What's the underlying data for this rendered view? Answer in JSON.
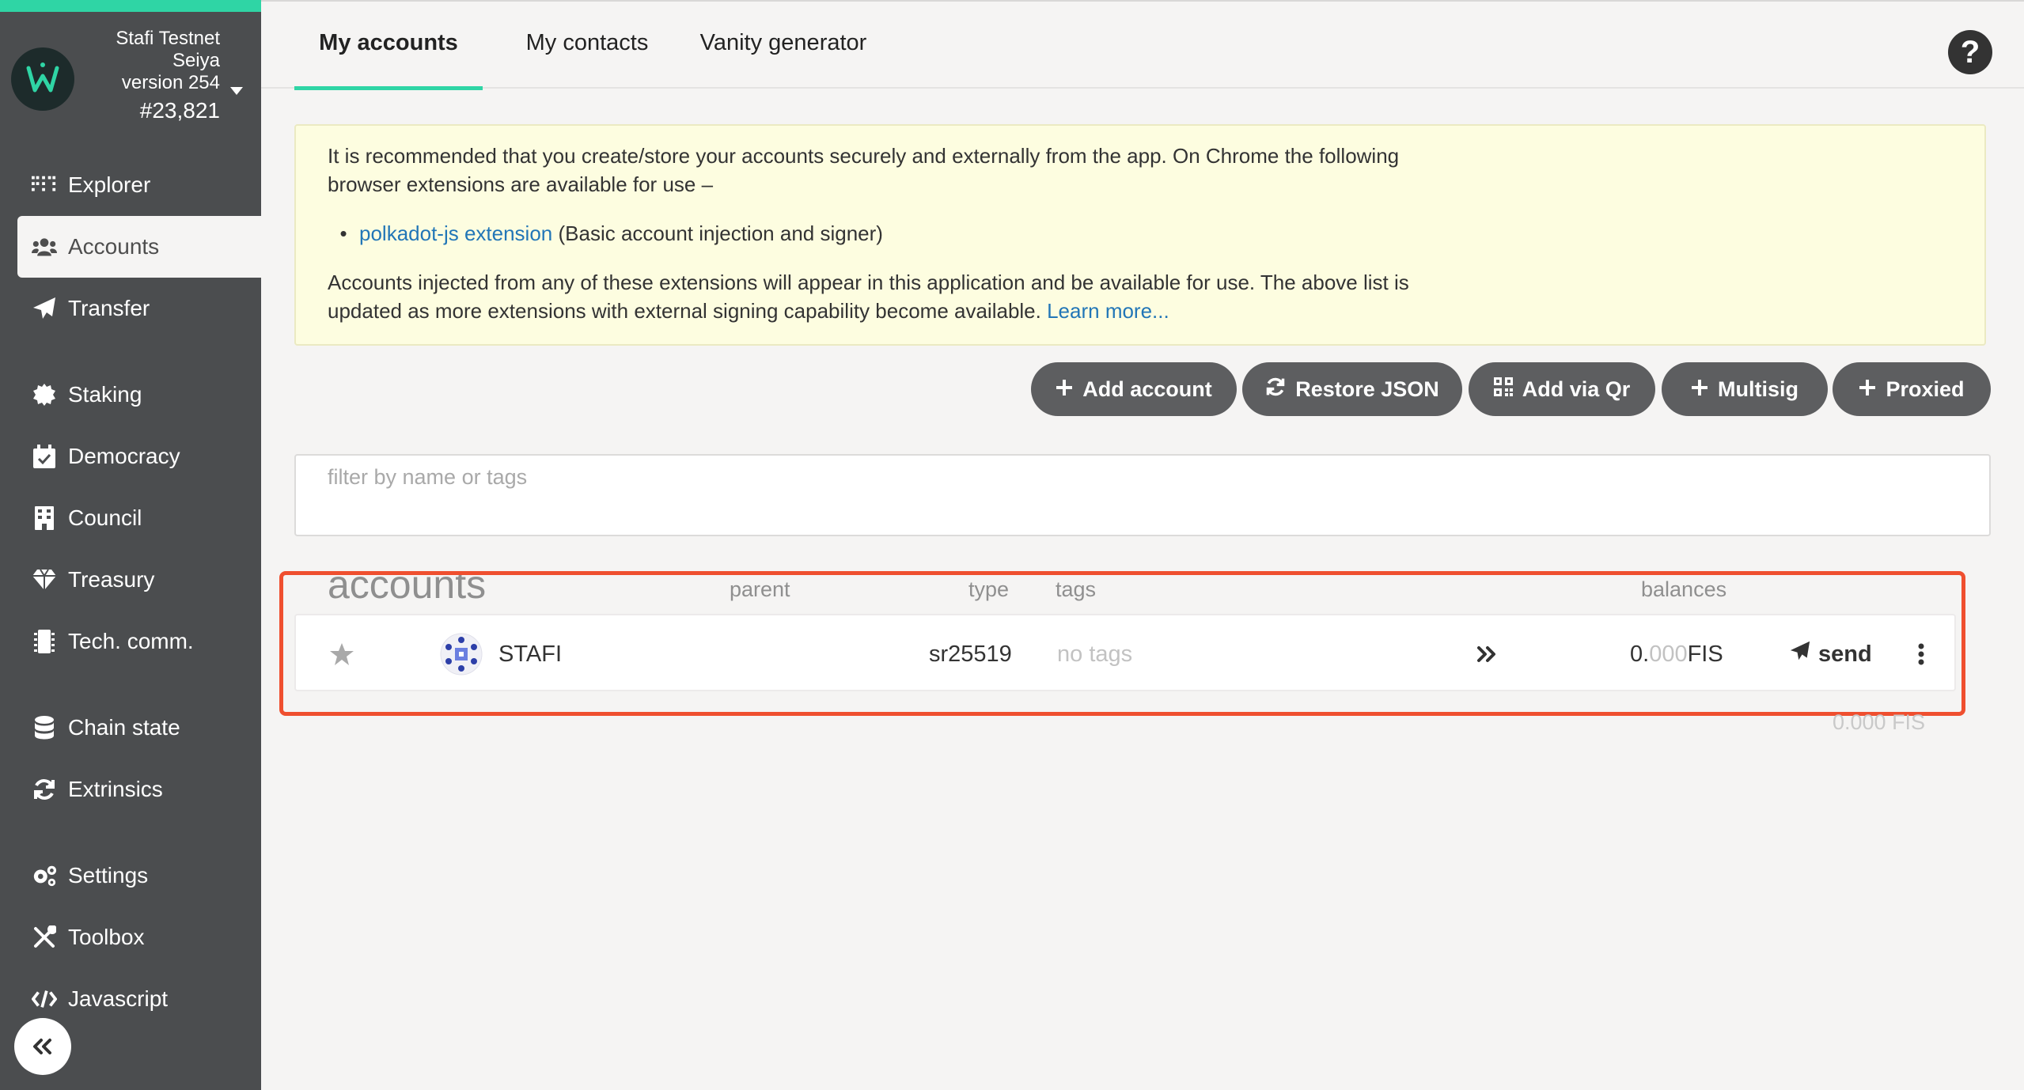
{
  "chain": {
    "name": "Stafi Testnet",
    "runtime": "Seiya",
    "version": "version 254",
    "block": "#23,821"
  },
  "sidebar": {
    "items": [
      {
        "label": "Explorer",
        "icon": "explorer-grid-icon"
      },
      {
        "label": "Accounts",
        "icon": "users-icon"
      },
      {
        "label": "Transfer",
        "icon": "paper-plane-icon"
      },
      {
        "label": "Staking",
        "icon": "certificate-icon"
      },
      {
        "label": "Democracy",
        "icon": "calendar-check-icon"
      },
      {
        "label": "Council",
        "icon": "building-icon"
      },
      {
        "label": "Treasury",
        "icon": "gem-icon"
      },
      {
        "label": "Tech. comm.",
        "icon": "microchip-icon"
      },
      {
        "label": "Chain state",
        "icon": "database-icon"
      },
      {
        "label": "Extrinsics",
        "icon": "sync-icon"
      },
      {
        "label": "Settings",
        "icon": "cogs-icon"
      },
      {
        "label": "Toolbox",
        "icon": "tools-icon"
      },
      {
        "label": "Javascript",
        "icon": "code-icon"
      }
    ],
    "active": "Accounts"
  },
  "tabs": [
    "My accounts",
    "My contacts",
    "Vanity generator"
  ],
  "banner": {
    "para1": "It is recommended that you create/store your accounts securely and externally from the app. On Chrome the following browser extensions are available for use –",
    "ext_link": "polkadot-js extension",
    "ext_desc": " (Basic account injection and signer)",
    "para2": "Accounts injected from any of these extensions will appear in this application and be available for use. The above list is updated as more extensions with external signing capability become available. ",
    "learn_more": "Learn more..."
  },
  "actions": {
    "add_account": "Add account",
    "restore_json": "Restore JSON",
    "add_via_qr": "Add via Qr",
    "multisig": "Multisig",
    "proxied": "Proxied"
  },
  "filter": {
    "placeholder": "filter by name or tags"
  },
  "table": {
    "title": "accounts",
    "headers": {
      "parent": "parent",
      "type": "type",
      "tags": "tags",
      "balances": "balances"
    },
    "rows": [
      {
        "name": "STAFI",
        "type": "sr25519",
        "tags": "no tags",
        "balance_int": "0.",
        "balance_dec": "000",
        "balance_unit": " FIS",
        "send": "send"
      }
    ],
    "total": "0.000 FIS"
  },
  "colors": {
    "accent": "#2fd5a5",
    "sidebar_bg": "#4b4d4f",
    "button_bg": "#5d5e60",
    "banner_bg": "#fdfde0",
    "highlight": "#ef4f2f",
    "link": "#2276b7"
  }
}
